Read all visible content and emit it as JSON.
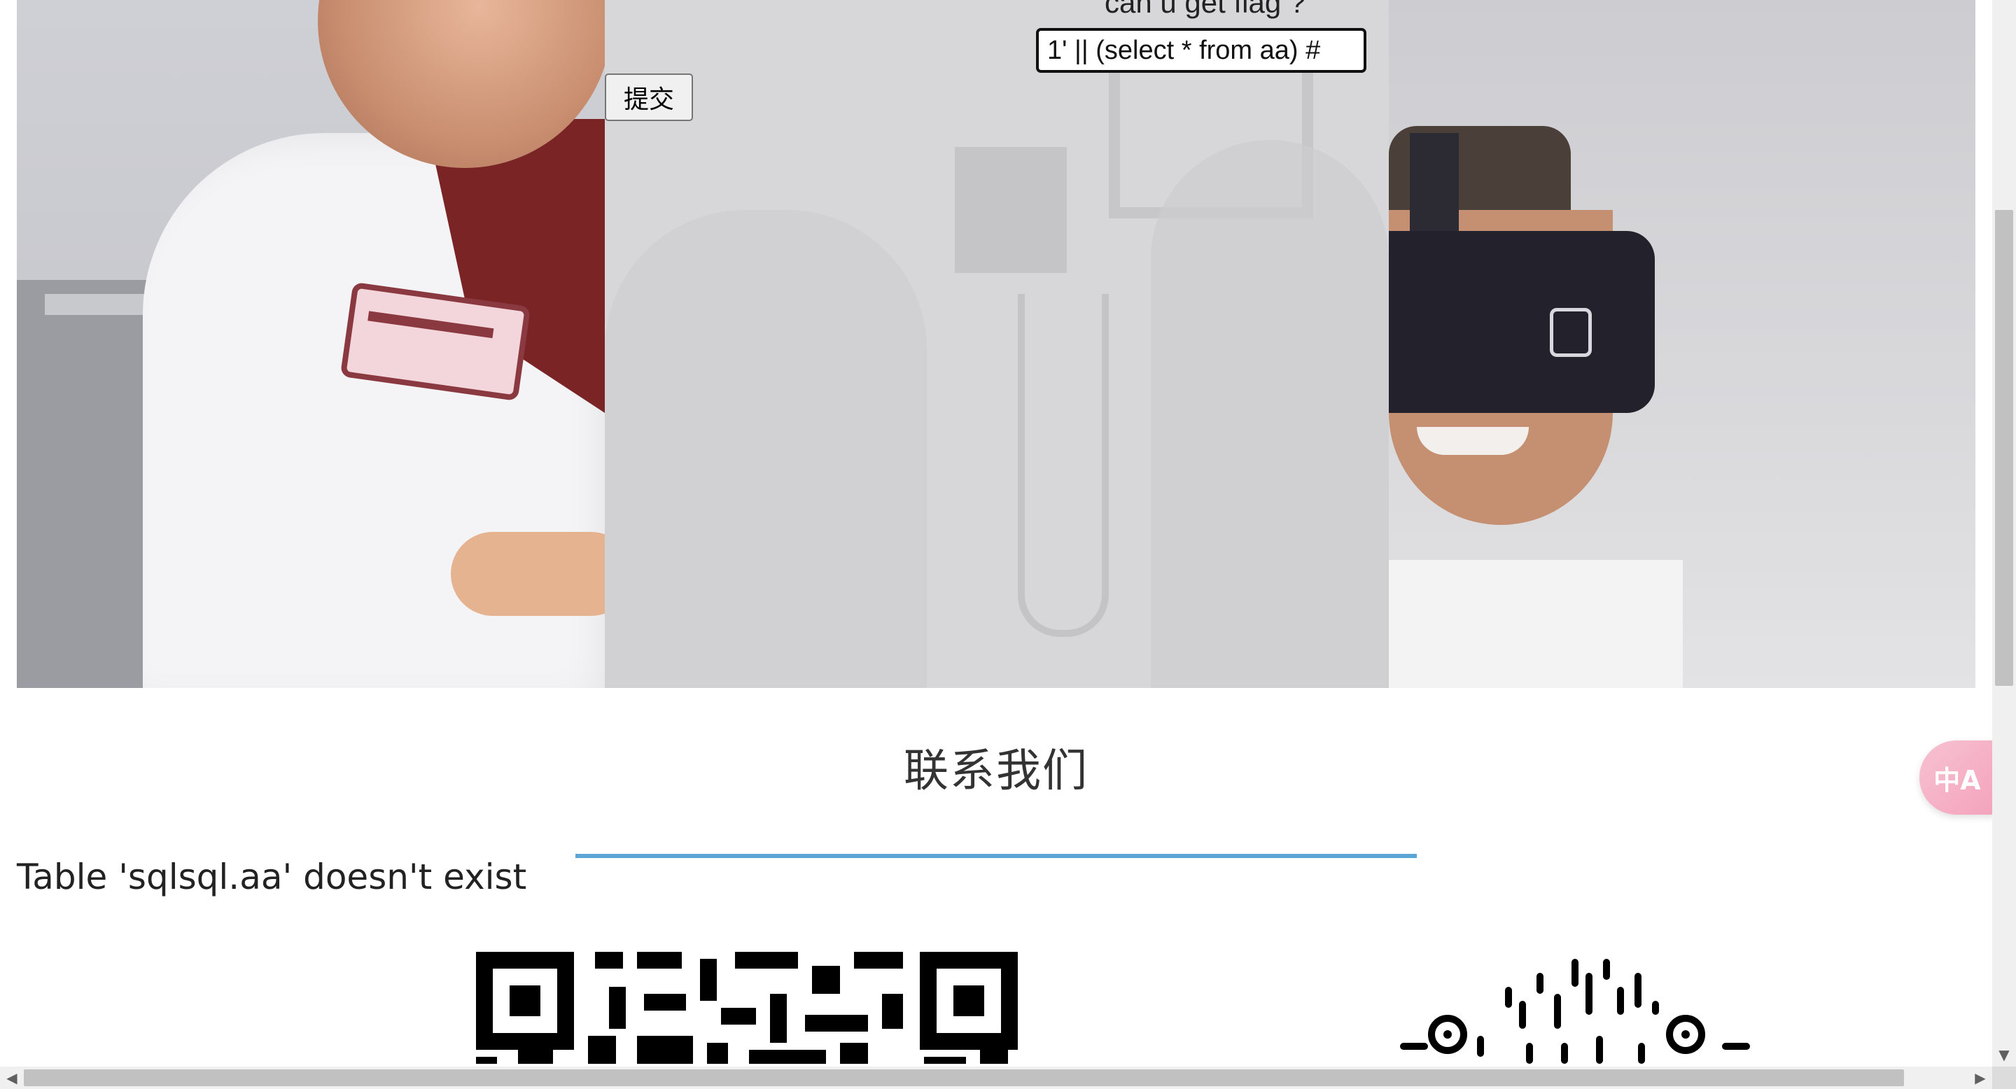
{
  "form": {
    "prompt": "can u get flag ?",
    "query_value": "1' || (select * from aa) #",
    "submit_label": "提交"
  },
  "contact": {
    "title": "联系我们",
    "accent_color": "#5aa5d6"
  },
  "result": {
    "error_message": "Table 'sqlsql.aa' doesn't exist"
  },
  "translate_widget": {
    "icon": "translate-icon",
    "glyph": "中A"
  },
  "scrollbars": {
    "left_arrow": "◀",
    "right_arrow": "▶",
    "down_arrow": "▼"
  }
}
